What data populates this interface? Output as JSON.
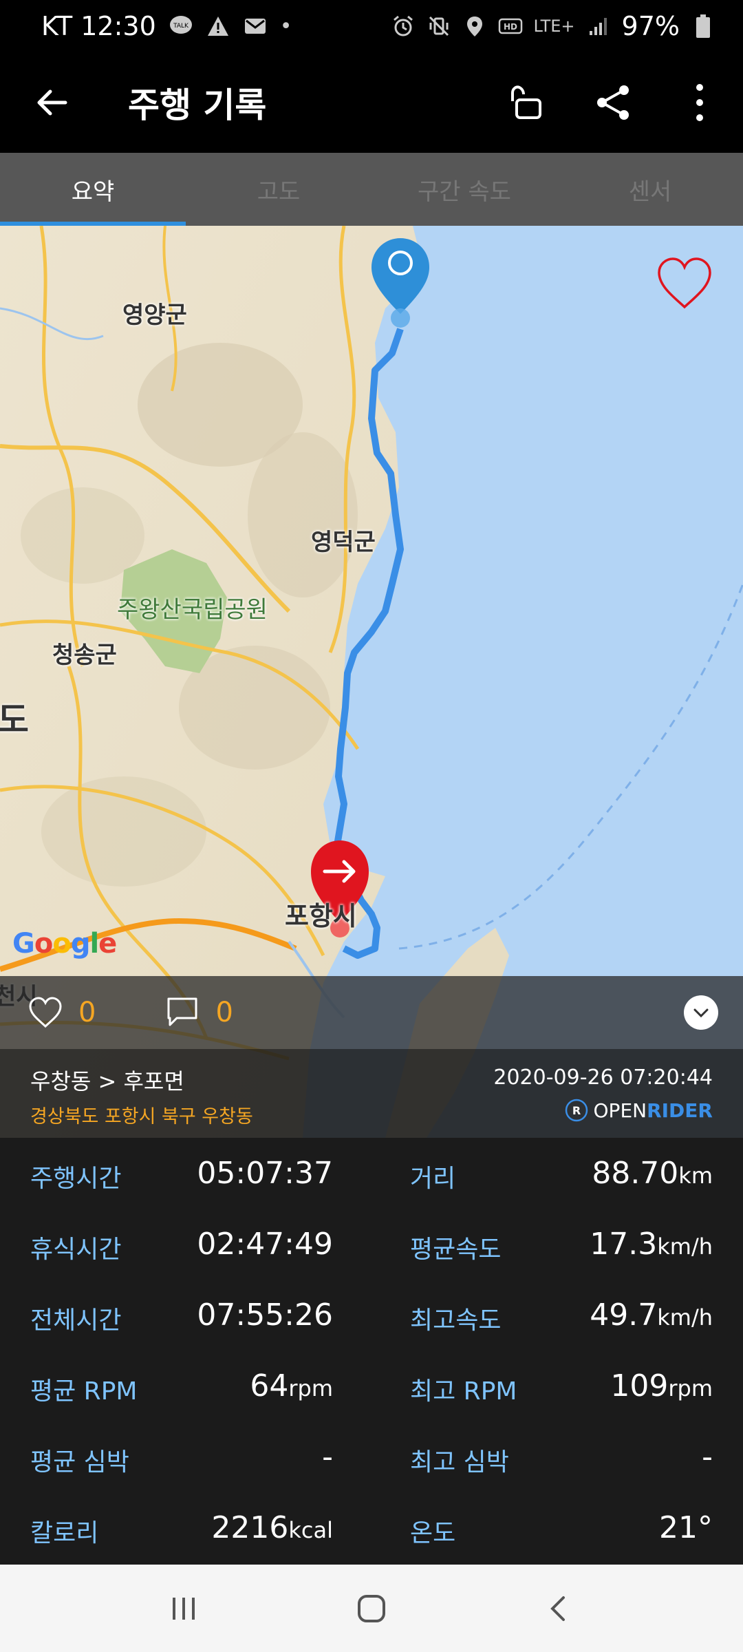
{
  "status_bar": {
    "carrier_time": "KT 12:30",
    "dot": "•",
    "battery": "97%",
    "network": "LTE+"
  },
  "app_bar": {
    "title": "주행 기록"
  },
  "tabs": [
    {
      "label": "요약",
      "active": true
    },
    {
      "label": "고도",
      "active": false
    },
    {
      "label": "구간 속도",
      "active": false
    },
    {
      "label": "센서",
      "active": false
    }
  ],
  "map": {
    "labels": {
      "yeongyang": "영양군",
      "yeongdeok": "영덕군",
      "juwangsan": "주왕산국립공원",
      "cheongsong": "청송군",
      "do": "도",
      "pohang": "포항시",
      "si_partial": "천시"
    },
    "google": "Google",
    "route_color": "#3a8ee6",
    "start_marker_color": "#2e8fd8",
    "end_marker_color": "#e0151f"
  },
  "social": {
    "likes": "0",
    "comments": "0"
  },
  "route": {
    "name": "우창동 > 후포면",
    "address": "경상북도 포항시 북구 우창동",
    "datetime": "2020-09-26 07:20:44",
    "brand_open": "OPEN",
    "brand_rider": "RIDER"
  },
  "stats": [
    {
      "left_label": "주행시간",
      "left_value": "05:07:37",
      "left_unit": "",
      "right_label": "거리",
      "right_value": "88.70",
      "right_unit": "km"
    },
    {
      "left_label": "휴식시간",
      "left_value": "02:47:49",
      "left_unit": "",
      "right_label": "평균속도",
      "right_value": "17.3",
      "right_unit": "km/h"
    },
    {
      "left_label": "전체시간",
      "left_value": "07:55:26",
      "left_unit": "",
      "right_label": "최고속도",
      "right_value": "49.7",
      "right_unit": "km/h"
    },
    {
      "left_label": "평균 RPM",
      "left_value": "64",
      "left_unit": "rpm",
      "right_label": "최고 RPM",
      "right_value": "109",
      "right_unit": "rpm"
    },
    {
      "left_label": "평균 심박",
      "left_value": "-",
      "left_unit": "",
      "right_label": "최고 심박",
      "right_value": "-",
      "right_unit": ""
    },
    {
      "left_label": "칼로리",
      "left_value": "2216",
      "left_unit": "kcal",
      "right_label": "온도",
      "right_value": "21°",
      "right_unit": ""
    }
  ],
  "colors": {
    "accent": "#2f8fde",
    "stat_label": "#7fc4ff",
    "highlight": "#f5a623"
  },
  "icons": {
    "back": "arrow-left-icon",
    "unlock": "unlock-icon",
    "share": "share-icon",
    "more": "more-vertical-icon",
    "favorite": "heart-outline-icon",
    "like": "heart-outline-icon",
    "comment": "comment-icon",
    "expand": "chevron-down-icon"
  }
}
